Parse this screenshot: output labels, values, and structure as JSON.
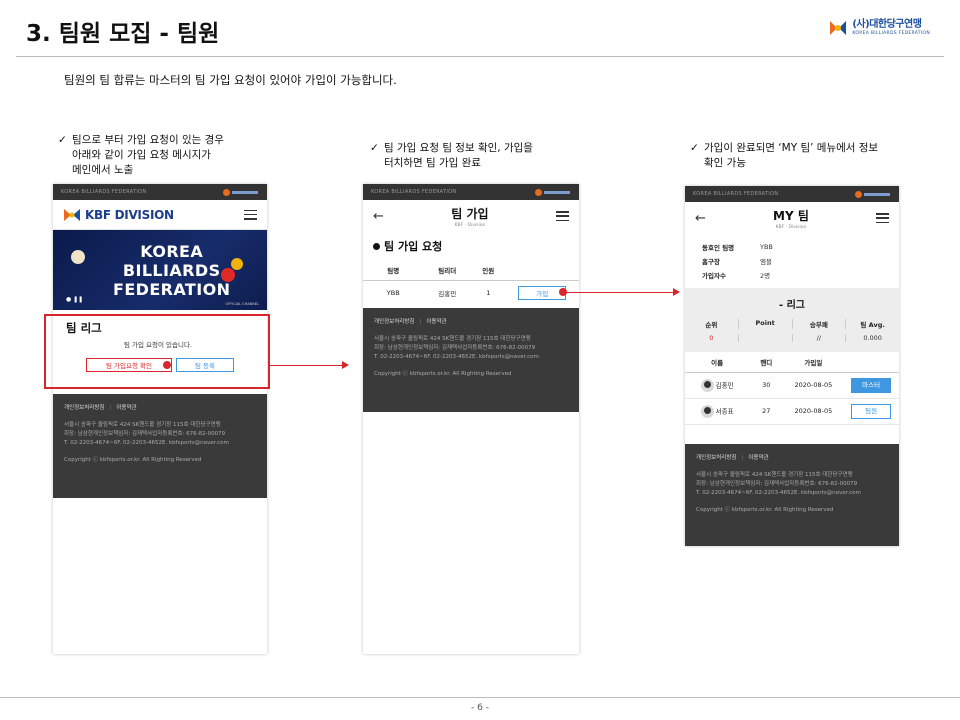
{
  "page": {
    "title": "3. 팀원 모집 - 팀원",
    "intro": "팀원의 팀 합류는 마스터의 팀 가입 요청이 있어야 가입이 가능합니다.",
    "page_number": "- 6 -"
  },
  "brand": {
    "name": "(사)대한당구연맹",
    "sub": "KOREA BILLIARDS FEDERATION"
  },
  "captions": {
    "step1": [
      "팀으로 부터 가입 요청이 있는 경우",
      "아래와 같이 가입 요청 메시지가",
      "메인에서 노출"
    ],
    "step2": [
      "팀 가입 요청 팀 정보 확인, 가입을",
      "터치하면 팀 가입 완료"
    ],
    "step3": [
      "가입이 완료되면 ‘MY 팀’ 메뉴에서 정보",
      "확인 가능"
    ]
  },
  "check_mark": "✓",
  "phone_common": {
    "top_text": "KOREA BILLIARDS FEDERATION",
    "footer_links": [
      "개인정보처리방침",
      "이용약관"
    ],
    "footer_address": "서울시 송파구 올림픽로 424 SK핸드볼 경기장 115호 대한당구연맹",
    "footer_rep": "회장: 남삼현개인정보책임자: 김재택사업자등록번호: 676-82-00079",
    "footer_contact": "T. 02-2203-4674~6F. 02-2203-4652E. kbfsports@naver.com",
    "footer_copy": "Copyright ⓒ kbfsports.or.kr. All Righting Reserved"
  },
  "phone1": {
    "logo_text": "KBF DIVISION",
    "banner_lines": [
      "KOREA",
      "BILLIARDS",
      "FEDERATION"
    ],
    "banner_badge": "OFFICIAL CHANNEL",
    "league_title": "팀 리그",
    "league_msg": "팀 가입 요청이 있습니다.",
    "btn_check": "팀 가입요청 확인",
    "btn_register": "팀 등록"
  },
  "phone2": {
    "title": "팀 가입",
    "subtitle": "KBF · Division",
    "section_title": "팀 가입 요청",
    "headers": [
      "팀명",
      "팀리더",
      "인원"
    ],
    "row": {
      "team": "YBB",
      "leader": "김홍민",
      "count": "1",
      "action": "가입"
    }
  },
  "phone3": {
    "title": "MY 팀",
    "subtitle": "KBF · Division",
    "info": [
      {
        "key": "동호인 팀명",
        "value": "YBB"
      },
      {
        "key": "홈구장",
        "value": "엠블"
      },
      {
        "key": "가입자수",
        "value": "2명"
      }
    ],
    "league_title": "- 리그",
    "league_headers": [
      "순위",
      "Point",
      "승무패",
      "팀 Avg."
    ],
    "league_values": [
      "0",
      "",
      "//",
      "0.000"
    ],
    "member_headers": [
      "이름",
      "핸디",
      "가입일",
      ""
    ],
    "members": [
      {
        "name": "김홍민",
        "handi": "30",
        "date": "2020-08-05",
        "role": "마스터"
      },
      {
        "name": "서종표",
        "handi": "27",
        "date": "2020-08-05",
        "role": "팀원"
      }
    ]
  },
  "colors": {
    "accent_red": "#d8262c",
    "accent_blue": "#3f97e1",
    "footer_bg": "#3a3a3a",
    "brand_blue": "#1d3d8f",
    "brand_orange": "#ec6a1e"
  }
}
